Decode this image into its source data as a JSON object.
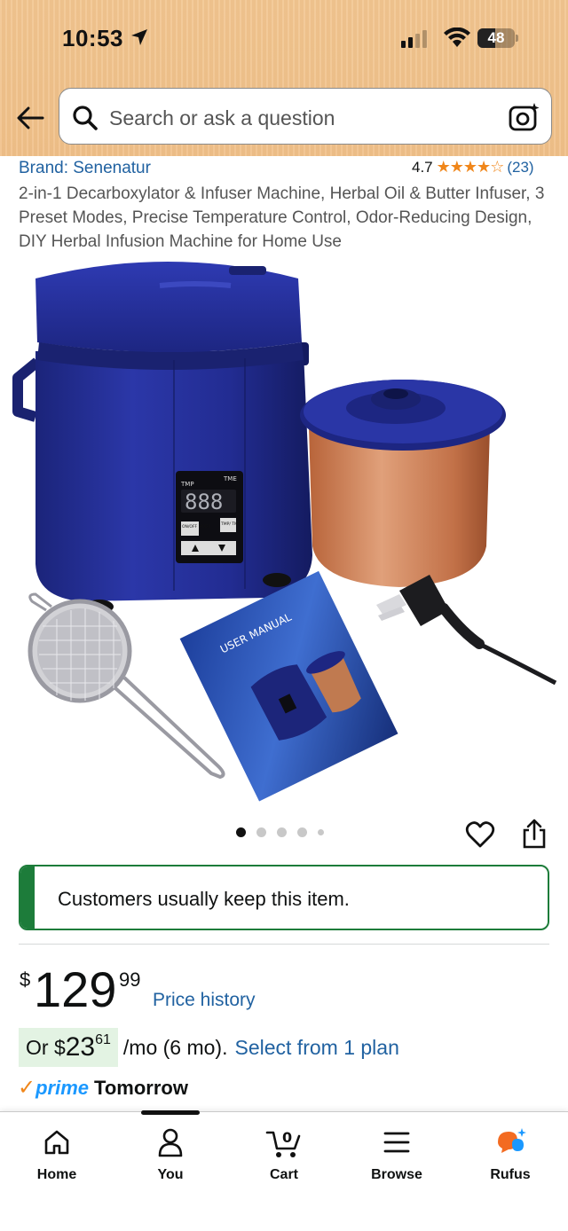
{
  "status_bar": {
    "time": "10:53",
    "battery": "48"
  },
  "search": {
    "placeholder": "Search or ask a question"
  },
  "product": {
    "brand": "Brand: Senenatur",
    "rating": "4.7",
    "stars": "★★★★☆",
    "review_count": "(23)",
    "title": "2-in-1 Decarboxylator & Infuser Machine, Herbal Oil & Butter Infuser, 3 Preset Modes, Precise Temperature Control, Odor-Reducing Design, DIY Herbal Infusion Machine for Home Use"
  },
  "image": {
    "labels": {
      "tmp": "TMP",
      "tme": "TME",
      "display": "888",
      "mode": "ON/OFF MODE",
      "tmp_tme": "TMP/ TME",
      "manual": "USER MANUAL"
    },
    "dots_total": 5,
    "dot_active": 1
  },
  "keep_banner": "Customers usually keep this item.",
  "price": {
    "currency": "$",
    "whole": "129",
    "fraction": "99",
    "history_label": "Price history"
  },
  "monthly": {
    "prefix": "Or $",
    "whole": "23",
    "fraction": "61",
    "suffix": "/mo (6 mo).",
    "link": "Select from 1 plan"
  },
  "delivery": {
    "prime_label": "prime",
    "day": "Tomorrow"
  },
  "nav": [
    {
      "label": "Home",
      "icon": "home-icon"
    },
    {
      "label": "You",
      "icon": "user-icon"
    },
    {
      "label": "Cart",
      "icon": "cart-icon",
      "count": "0"
    },
    {
      "label": "Browse",
      "icon": "menu-icon"
    },
    {
      "label": "Rufus",
      "icon": "rufus-icon"
    }
  ],
  "colors": {
    "header": "#f2c58f",
    "link": "#2162a1",
    "green": "#1d7c3a",
    "star": "#f0861a",
    "prime": "#1a98ff"
  }
}
